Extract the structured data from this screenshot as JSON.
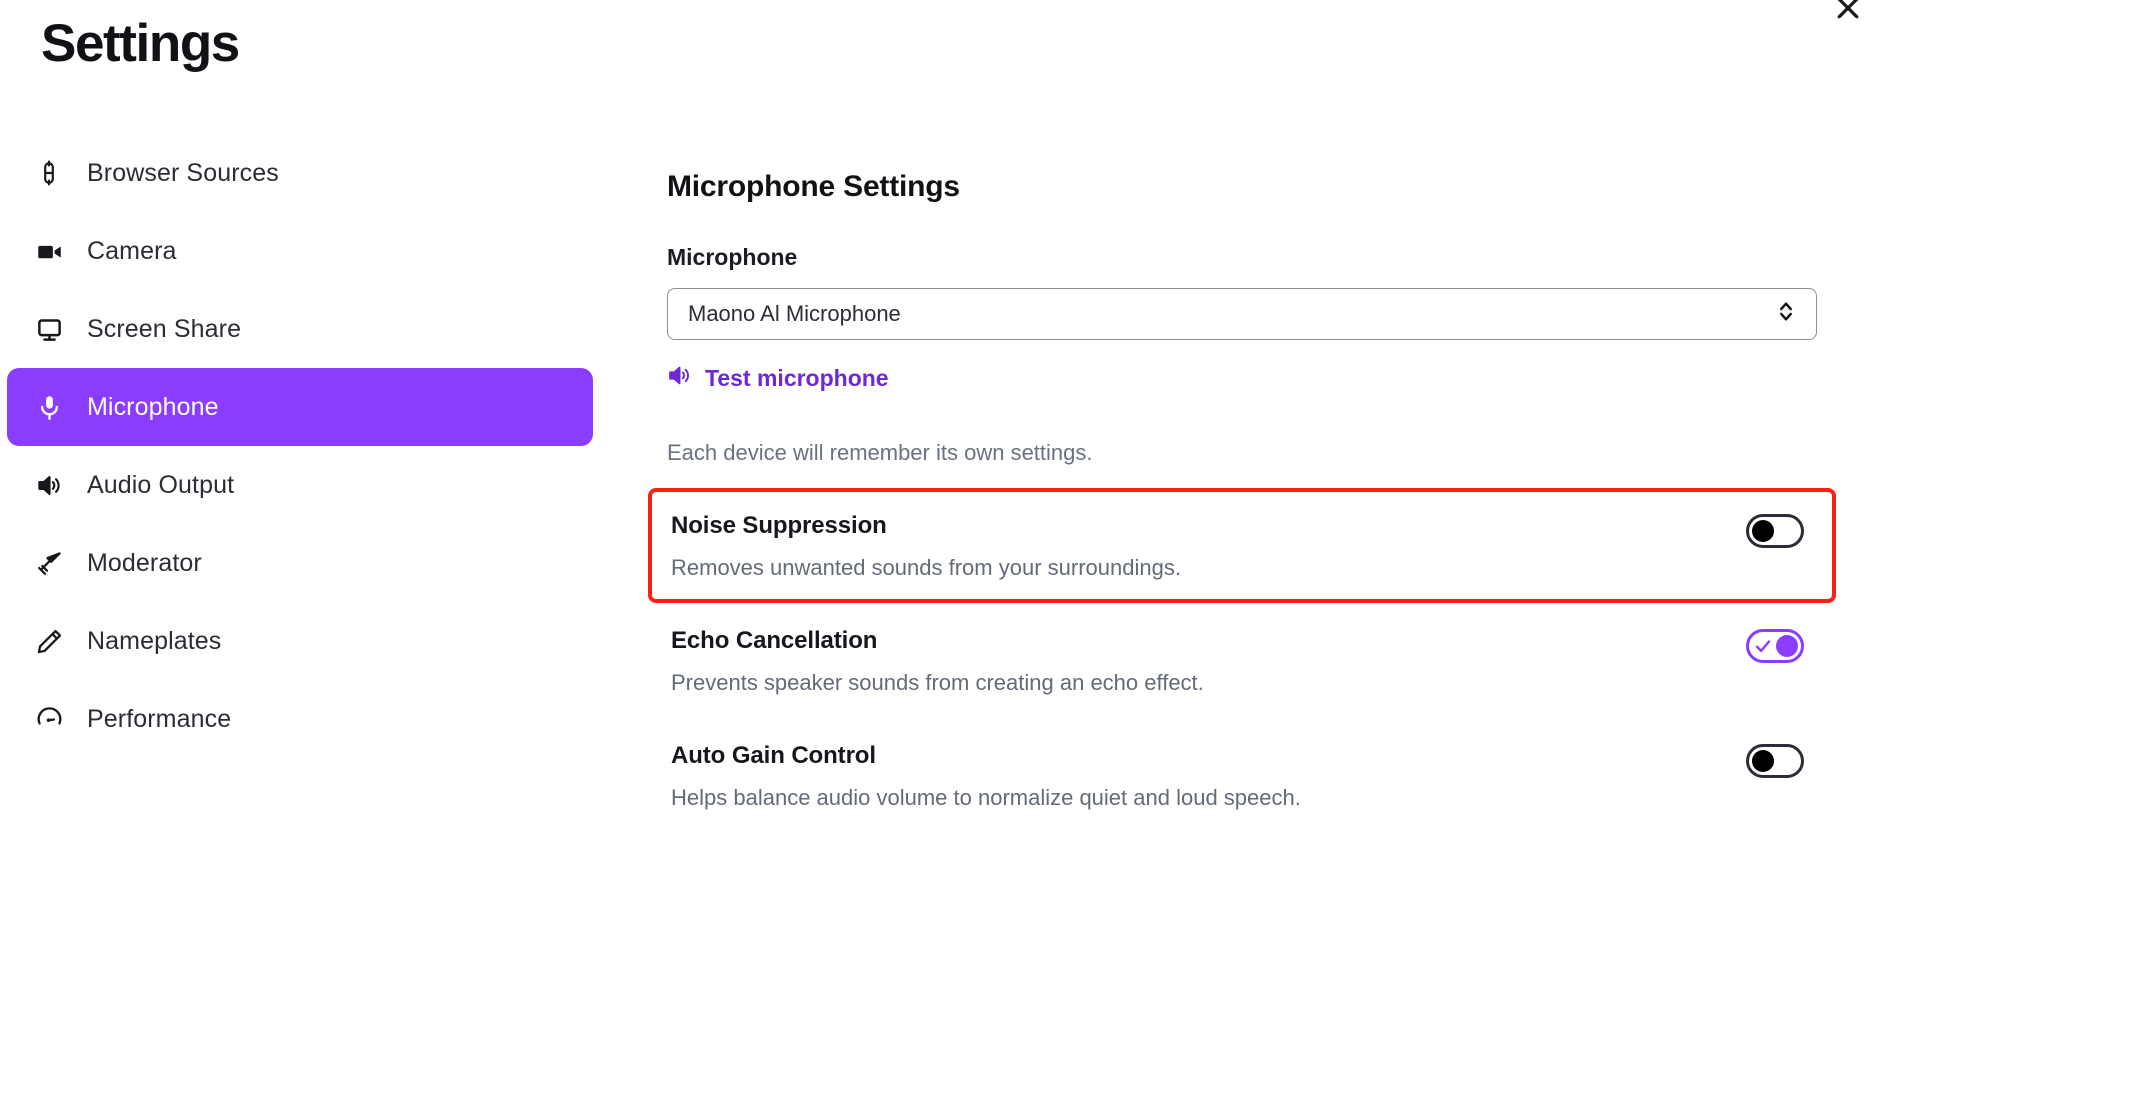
{
  "window": {
    "title": "Settings",
    "close_icon": "close-icon"
  },
  "sidebar": {
    "items": [
      {
        "label": "Browser Sources",
        "icon": "link-icon",
        "active": false
      },
      {
        "label": "Camera",
        "icon": "video-camera-icon",
        "active": false
      },
      {
        "label": "Screen Share",
        "icon": "monitor-icon",
        "active": false
      },
      {
        "label": "Microphone",
        "icon": "microphone-icon",
        "active": true
      },
      {
        "label": "Audio Output",
        "icon": "speaker-icon",
        "active": false
      },
      {
        "label": "Moderator",
        "icon": "sword-icon",
        "active": false
      },
      {
        "label": "Nameplates",
        "icon": "pencil-icon",
        "active": false
      },
      {
        "label": "Performance",
        "icon": "gauge-icon",
        "active": false
      }
    ]
  },
  "main": {
    "section_title": "Microphone Settings",
    "device_field": {
      "label": "Microphone",
      "selected_value": "Maono Al Microphone",
      "arrow_icon": "chevron-up-down-icon"
    },
    "test_microphone": {
      "label": "Test microphone",
      "icon": "speaker-wave-icon"
    },
    "hint": "Each device will remember its own settings.",
    "toggles": [
      {
        "name": "Noise Suppression",
        "description": "Removes unwanted sounds from your surroundings.",
        "state": "off",
        "highlighted": true
      },
      {
        "name": "Echo Cancellation",
        "description": "Prevents speaker sounds from creating an echo effect.",
        "state": "on",
        "highlighted": false
      },
      {
        "name": "Auto Gain Control",
        "description": "Helps balance audio volume to normalize quiet and loud speech.",
        "state": "off",
        "highlighted": false
      }
    ]
  },
  "colors": {
    "accent_purple": "#8B3DFF",
    "link_purple": "#6d28d9",
    "highlight_red": "#fc1f13",
    "text_primary": "#111216",
    "text_muted": "#646b77"
  }
}
